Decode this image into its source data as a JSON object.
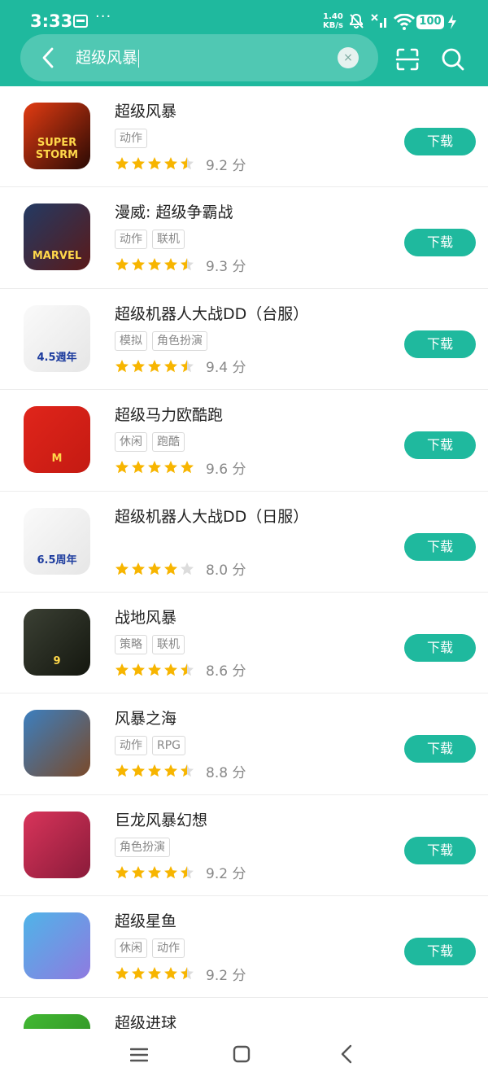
{
  "status_bar": {
    "time": "3:33",
    "net_speed_value": "1.40",
    "net_speed_unit": "KB/s",
    "battery": "100"
  },
  "search": {
    "query": "超级风暴",
    "clear_glyph": "×"
  },
  "apps": [
    {
      "name": "超级风暴",
      "tags": [
        "动作"
      ],
      "stars": 4.5,
      "score": "9.2 分",
      "button": "下载",
      "icon_colors": [
        "#e23b12",
        "#2a0a04"
      ],
      "icon_text": "SUPER STORM"
    },
    {
      "name": "漫威: 超级争霸战",
      "tags": [
        "动作",
        "联机"
      ],
      "stars": 4.5,
      "score": "9.3 分",
      "button": "下载",
      "icon_colors": [
        "#233a63",
        "#5a1a1a"
      ],
      "icon_text": "MARVEL"
    },
    {
      "name": "超级机器人大战DD（台服）",
      "tags": [
        "模拟",
        "角色扮演"
      ],
      "stars": 4.5,
      "score": "9.4 分",
      "button": "下载",
      "icon_colors": [
        "#fafafa",
        "#e6e6e6"
      ],
      "icon_text": "4.5週年"
    },
    {
      "name": "超级马力欧酷跑",
      "tags": [
        "休闲",
        "跑酷"
      ],
      "stars": 5,
      "score": "9.6 分",
      "button": "下载",
      "icon_colors": [
        "#e0251b",
        "#c41a12"
      ],
      "icon_text": "M"
    },
    {
      "name": "超级机器人大战DD（日服）",
      "tags": [],
      "stars": 4,
      "score": "8.0 分",
      "button": "下载",
      "icon_colors": [
        "#fafafa",
        "#e6e6e6"
      ],
      "icon_text": "6.5周年"
    },
    {
      "name": "战地风暴",
      "tags": [
        "策略",
        "联机"
      ],
      "stars": 4.5,
      "score": "8.6 分",
      "button": "下载",
      "icon_colors": [
        "#3b4034",
        "#14170f"
      ],
      "icon_text": "9"
    },
    {
      "name": "风暴之海",
      "tags": [
        "动作",
        "RPG"
      ],
      "stars": 4.5,
      "score": "8.8 分",
      "button": "下载",
      "icon_colors": [
        "#3c7fbf",
        "#7a4a2a"
      ],
      "icon_text": ""
    },
    {
      "name": "巨龙风暴幻想",
      "tags": [
        "角色扮演"
      ],
      "stars": 4.5,
      "score": "9.2 分",
      "button": "下载",
      "icon_colors": [
        "#d8345a",
        "#8a1b3a"
      ],
      "icon_text": ""
    },
    {
      "name": "超级星鱼",
      "tags": [
        "休闲",
        "动作"
      ],
      "stars": 4.5,
      "score": "9.2 分",
      "button": "下载",
      "icon_colors": [
        "#4fb4e8",
        "#8f7ae0"
      ],
      "icon_text": ""
    },
    {
      "name": "超级进球",
      "tags": [],
      "stars": 0,
      "score": "",
      "button": "",
      "icon_colors": [
        "#42b833",
        "#2d8a22"
      ],
      "icon_text": ""
    }
  ],
  "colors": {
    "accent": "#1fb99e",
    "star": "#f7b500",
    "star_empty": "#dcdcdc"
  }
}
